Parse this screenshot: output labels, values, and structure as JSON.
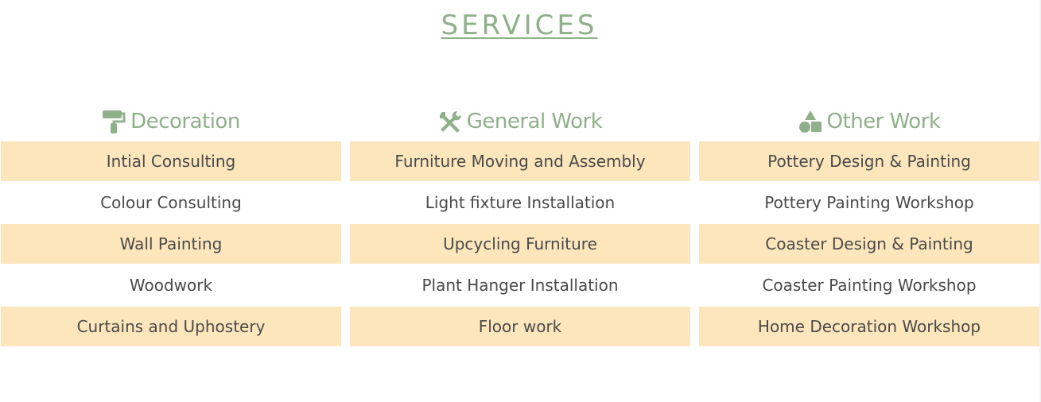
{
  "title": "SERVICES",
  "colors": {
    "accent": "#8fb08a",
    "row_fill": "#fde5bc",
    "text": "#4a4a4a"
  },
  "columns": [
    {
      "heading": "Decoration",
      "icon": "paint-roller-icon",
      "items": [
        "Intial Consulting",
        "Colour Consulting",
        "Wall Painting",
        "Woodwork",
        "Curtains and Uphostery"
      ]
    },
    {
      "heading": "General Work",
      "icon": "tools-icon",
      "items": [
        "Furniture Moving and Assembly",
        "Light fixture Installation",
        "Upcycling Furniture",
        "Plant Hanger Installation",
        "Floor work"
      ]
    },
    {
      "heading": "Other Work",
      "icon": "shapes-icon",
      "items": [
        "Pottery Design & Painting",
        "Pottery Painting Workshop",
        "Coaster Design & Painting",
        "Coaster Painting Workshop",
        "Home Decoration Workshop"
      ]
    }
  ]
}
